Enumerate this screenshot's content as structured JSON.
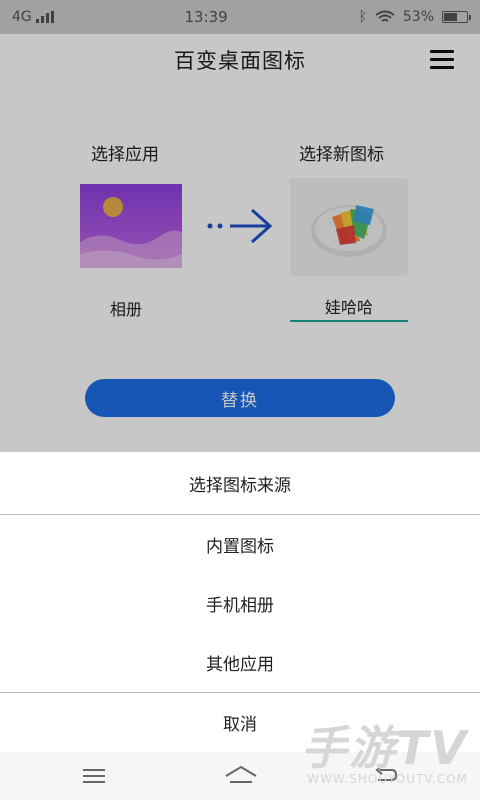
{
  "statusbar": {
    "network": "4G",
    "time": "13:39",
    "battery_percent": "53%",
    "battery_level": 0.53
  },
  "header": {
    "title": "百变桌面图标"
  },
  "main": {
    "select_app_label": "选择应用",
    "select_icon_label": "选择新图标",
    "app_name": "相册",
    "new_name_value": "娃哈哈",
    "replace_label": "替换"
  },
  "sheet": {
    "title": "选择图标来源",
    "options": [
      "内置图标",
      "手机相册",
      "其他应用"
    ],
    "cancel": "取消"
  },
  "watermark": {
    "brand": "手游TV",
    "url": "WWW.SHOUYOUTV.COM"
  },
  "colors": {
    "accent": "#1e6fe8",
    "input_underline": "#1aa99a"
  }
}
